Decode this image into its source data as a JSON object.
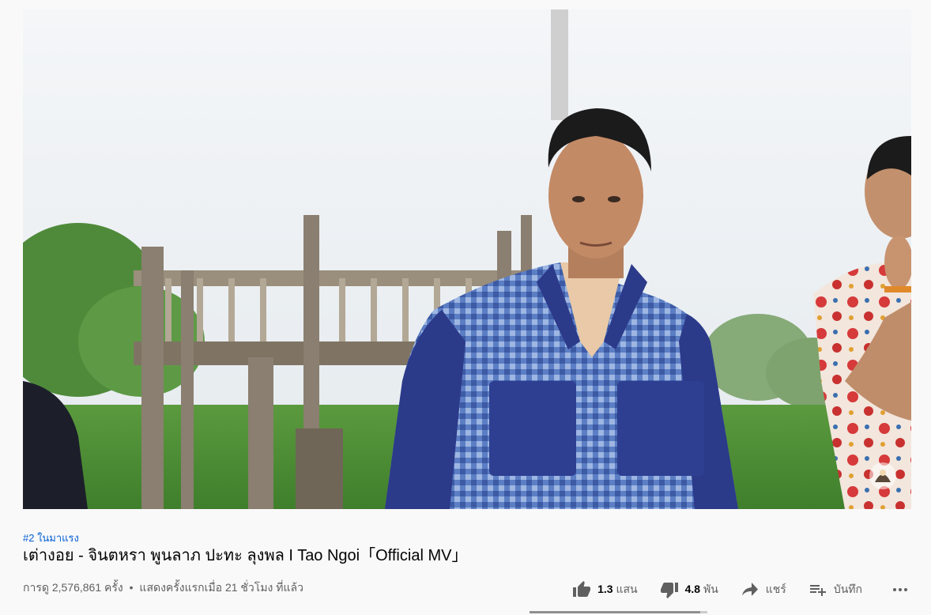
{
  "video": {
    "description_hidden": ""
  },
  "info": {
    "trending_tag": "#2 ในมาแรง",
    "title": "เต่างอย - จินตหรา พูนลาภ ปะทะ ลุงพล I Tao Ngoi「Official MV」",
    "views": "การดู 2,576,861 ครั้ง",
    "separator": "•",
    "premiered": "แสดงครั้งแรกเมื่อ 21 ชั่วโมง ที่แล้ว"
  },
  "actions": {
    "like": {
      "count": "1.3",
      "unit": "แสน",
      "icon": "thumb-up-icon"
    },
    "dislike": {
      "count": "4.8",
      "unit": "พัน",
      "icon": "thumb-down-icon"
    },
    "share": {
      "label": "แชร์",
      "icon": "share-icon"
    },
    "save": {
      "label": "บันทึก",
      "icon": "playlist-add-icon"
    },
    "more": {
      "icon": "more-horizontal-icon"
    }
  },
  "sentiment": {
    "like_ratio": 0.96
  },
  "colors": {
    "link": "#065fd4",
    "text_primary": "#030303",
    "text_secondary": "#606060",
    "background": "#f9f9f9"
  }
}
